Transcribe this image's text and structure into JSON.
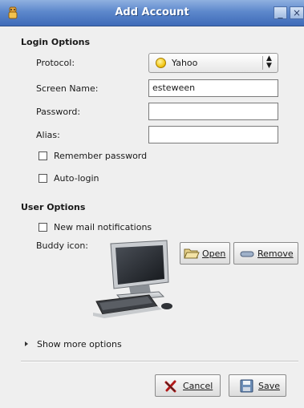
{
  "window": {
    "title": "Add Account",
    "minimize_glyph": "_",
    "close_glyph": "×"
  },
  "login_options": {
    "heading": "Login Options",
    "protocol_label": "Protocol:",
    "protocol_value": "Yahoo",
    "protocol_icon": "yahoo-smiley-icon",
    "screen_name_label": "Screen Name:",
    "screen_name_value": "esteween",
    "password_label": "Password:",
    "password_value": "",
    "alias_label": "Alias:",
    "alias_value": "",
    "remember_password_label": "Remember password",
    "remember_password_checked": false,
    "auto_login_label": "Auto-login",
    "auto_login_checked": false
  },
  "user_options": {
    "heading": "User Options",
    "new_mail_label": "New mail notifications",
    "new_mail_checked": false,
    "buddy_icon_label": "Buddy icon:",
    "open_label": "Open",
    "open_icon": "folder-open-icon",
    "remove_label": "Remove",
    "remove_icon": "remove-icon"
  },
  "more": {
    "expander_label": "Show more options"
  },
  "actions": {
    "cancel_label": "Cancel",
    "cancel_icon": "cancel-x-icon",
    "save_label": "Save",
    "save_icon": "floppy-save-icon"
  }
}
